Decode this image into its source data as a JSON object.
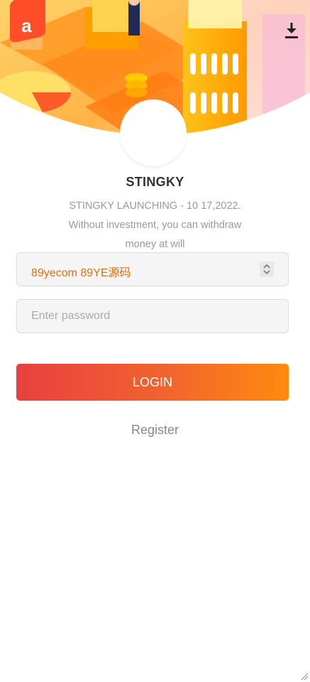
{
  "header": {
    "download_icon": "download-icon",
    "illustration": "isometric-finance-illustration"
  },
  "brand": {
    "name": "STINGKY",
    "description": "STINGKY LAUNCHING - 10 17,2022. Without investment, you can withdraw money at will"
  },
  "form": {
    "account_select": {
      "selected": "89yecom 89YE源码",
      "icon": "chevron-up-down-icon"
    },
    "password": {
      "placeholder": "Enter password",
      "value": ""
    },
    "login_label": "LOGIN",
    "register_label": "Register"
  },
  "colors": {
    "accent_start": "#e84040",
    "accent_end": "#ff8a10",
    "select_text": "#e07010",
    "hero_bg": "#fff3d6"
  }
}
